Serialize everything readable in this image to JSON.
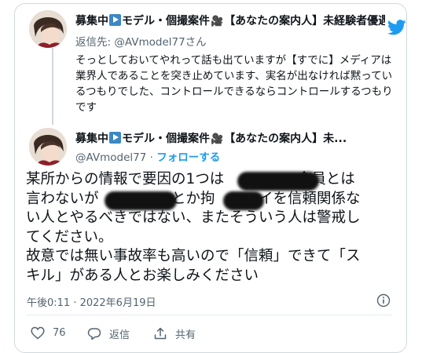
{
  "reply_tweet": {
    "display_name_a": "募集中",
    "display_name_b": "モデル・個撮案件",
    "display_name_c": "【あなたの案内人】未経験者優遇",
    "reply_prefix": "返信先:",
    "reply_to": "@AVmodel77さん",
    "body": "そっとしておいてやれって話も出ていますが【すでに】メディアは業界人であることを突き止めています、実名が出なければ黙っているつもりでした、コントロールできるならコントロールするつもりです"
  },
  "main_tweet": {
    "display_name_a": "募集中",
    "display_name_b": "モデル・個撮案件",
    "display_name_c": "【あなたの案内人】未...",
    "handle": "@AVmodel77",
    "separator": "·",
    "follow_label": "フォローする",
    "body": "某所からの情報で要因の1つは　　　　　全員とは\n言わないが　　　　　とか拘　　　イを信頼関係な\nい人とやるべきではない、またそういう人は警戒し\nてください。\n故意では無い事故率も高いので「信頼」できて「ス\nキル」がある人とお楽しみください",
    "timestamp": "午後0:11 · 2022年6月19日",
    "likes": "76",
    "reply_label": "返信",
    "share_label": "共有"
  },
  "colors": {
    "accent": "#1d9bf0",
    "muted": "#536471",
    "border": "#cfd9de",
    "play_box": "#3b88c3"
  },
  "icons": [
    "twitter-bird-icon",
    "play-button-emoji",
    "movie-camera-emoji",
    "info-icon",
    "heart-icon",
    "reply-icon",
    "share-icon"
  ]
}
